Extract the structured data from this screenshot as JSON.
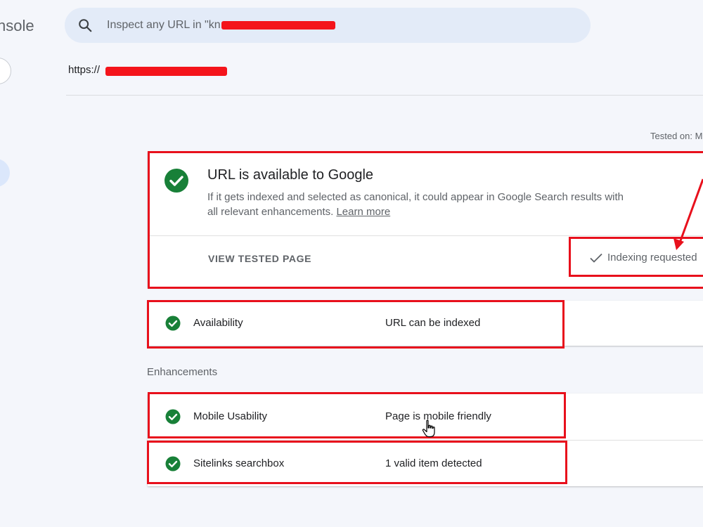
{
  "sidebar": {
    "console_text": "nsole"
  },
  "search": {
    "placeholder": "Inspect any URL in \"kn"
  },
  "inspected_url": {
    "prefix": "https://"
  },
  "tested_on": "Tested on: M",
  "main_card": {
    "title": "URL is available to Google",
    "description": "If it gets indexed and selected as canonical, it could appear in Google Search results with all relevant enhancements.",
    "learn_more": "Learn more",
    "view_tested_page": "VIEW TESTED PAGE",
    "indexing_requested": "Indexing requested"
  },
  "availability": {
    "label": "Availability",
    "value": "URL can be indexed"
  },
  "enhancements": {
    "heading": "Enhancements",
    "items": [
      {
        "label": "Mobile Usability",
        "value": "Page is mobile friendly"
      },
      {
        "label": "Sitelinks searchbox",
        "value": "1 valid item detected"
      }
    ]
  },
  "colors": {
    "success_green": "#188038",
    "annotation_red": "#e8101c",
    "search_bg": "#e3ebf8"
  }
}
